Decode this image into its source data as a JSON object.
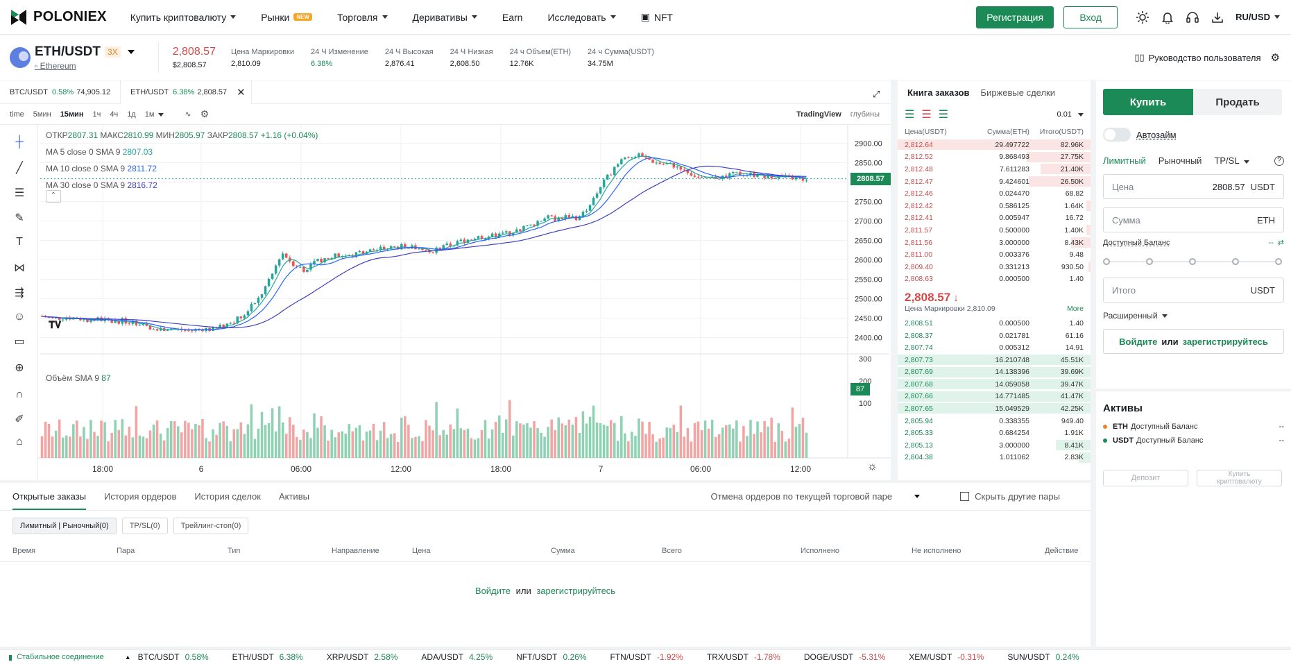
{
  "nav": {
    "brand": "POLONIEX",
    "items": [
      {
        "label": "Купить криптовалюту",
        "caret": true
      },
      {
        "label": "Рынки",
        "badge": "NEW"
      },
      {
        "label": "Торговля",
        "caret": true
      },
      {
        "label": "Деривативы",
        "caret": true
      },
      {
        "label": "Earn"
      },
      {
        "label": "Исследовать",
        "caret": true
      },
      {
        "label": "NFT"
      }
    ],
    "register": "Регистрация",
    "login": "Вход",
    "lang": "RU/USD"
  },
  "ticker": {
    "pair": "ETH/USDT",
    "leverage": "3X",
    "coin": "Ethereum",
    "price": "2,808.57",
    "price_usd": "$2,808.57",
    "stats": [
      {
        "label": "Цена Маркировки",
        "value": "2,810.09",
        "color": "#1b1f24"
      },
      {
        "label": "24 Ч Изменение",
        "value": "6.38%",
        "color": "#1c8a57"
      },
      {
        "label": "24 Ч Высокая",
        "value": "2,876.41",
        "color": "#1b1f24"
      },
      {
        "label": "24 Ч Низкая",
        "value": "2,608.50",
        "color": "#1b1f24"
      },
      {
        "label": "24 ч Объем(ETH)",
        "value": "12.76K",
        "color": "#1b1f24"
      },
      {
        "label": "24 ч Сумма(USDT)",
        "value": "34.75M",
        "color": "#1b1f24"
      }
    ],
    "guide": "Руководство пользователя"
  },
  "chart_tabs": [
    {
      "pair": "BTC/USDT",
      "change": "0.58%",
      "price": "74,905.12"
    },
    {
      "pair": "ETH/USDT",
      "change": "6.38%",
      "price": "2,808.57"
    }
  ],
  "toolbar": {
    "intervals": [
      "time",
      "5мин",
      "15мин",
      "1ч",
      "4ч",
      "1д",
      "1м"
    ],
    "tradingview": "TradingView",
    "depth": "глубины"
  },
  "chart_legend": {
    "ohlc": {
      "open_label": "ОТКР",
      "open": "2807.31",
      "high_label": "МАКС",
      "high": "2810.99",
      "low_label": "МИН",
      "low": "2805.97",
      "close_label": "ЗАКР",
      "close": "2808.57",
      "change": "+1.16 (+0.04%)"
    },
    "ma": [
      {
        "label": "MA 5 close 0 SMA 9",
        "value": "2807.03",
        "color": "#26a69a"
      },
      {
        "label": "MA 10 close 0 SMA 9",
        "value": "2811.72",
        "color": "#2962ff"
      },
      {
        "label": "MA 30 close 0 SMA 9",
        "value": "2816.72",
        "color": "#3f3fbf"
      }
    ],
    "volume_label": "Объём SMA 9",
    "volume_value": "87",
    "current_price_tag": "2808.57",
    "current_volume_tag": "87"
  },
  "chart_data": {
    "type": "candlestick",
    "price_axis": [
      "2900.00",
      "2850.00",
      "2800.00",
      "2750.00",
      "2700.00",
      "2650.00",
      "2600.00",
      "2550.00",
      "2500.00",
      "2450.00",
      "2400.00"
    ],
    "volume_axis": [
      "300",
      "200",
      "100"
    ],
    "time_axis": [
      "18:00",
      "6",
      "06:00",
      "12:00",
      "18:00",
      "7",
      "06:00",
      "12:00"
    ],
    "ylim": [
      2390,
      2915
    ],
    "close_path": [
      2455,
      2448,
      2452,
      2450,
      2445,
      2447,
      2440,
      2443,
      2438,
      2436,
      2418,
      2425,
      2420,
      2417,
      2423,
      2420,
      2432,
      2445,
      2470,
      2500,
      2550,
      2620,
      2590,
      2575,
      2595,
      2605,
      2612,
      2608,
      2620,
      2625,
      2628,
      2632,
      2635,
      2628,
      2622,
      2632,
      2640,
      2650,
      2658,
      2660,
      2664,
      2670,
      2680,
      2690,
      2710,
      2705,
      2712,
      2708,
      2740,
      2790,
      2830,
      2862,
      2870,
      2860,
      2848,
      2845,
      2838,
      2820,
      2805,
      2812,
      2815,
      2822,
      2820,
      2818,
      2815,
      2812,
      2810,
      2808
    ]
  },
  "orderbook": {
    "tabs": [
      "Книга заказов",
      "Биржевые сделки"
    ],
    "precision": "0.01",
    "headers": [
      "Цена(USDT)",
      "Сумма(ETH)",
      "Итого(USDT)"
    ],
    "asks": [
      {
        "price": "2,812.64",
        "amount": "29.497722",
        "total": "82.96K",
        "depth": 1.0
      },
      {
        "price": "2,812.52",
        "amount": "9.868493",
        "total": "27.75K",
        "depth": 0.33
      },
      {
        "price": "2,812.48",
        "amount": "7.611283",
        "total": "21.40K",
        "depth": 0.26
      },
      {
        "price": "2,812.47",
        "amount": "9.424601",
        "total": "26.50K",
        "depth": 0.32
      },
      {
        "price": "2,812.46",
        "amount": "0.024470",
        "total": "68.82",
        "depth": 0.0
      },
      {
        "price": "2,812.42",
        "amount": "0.586125",
        "total": "1.64K",
        "depth": 0.02
      },
      {
        "price": "2,812.41",
        "amount": "0.005947",
        "total": "16.72",
        "depth": 0.0
      },
      {
        "price": "2,811.57",
        "amount": "0.500000",
        "total": "1.40K",
        "depth": 0.02
      },
      {
        "price": "2,811.56",
        "amount": "3.000000",
        "total": "8.43K",
        "depth": 0.1
      },
      {
        "price": "2,811.00",
        "amount": "0.003376",
        "total": "9.48",
        "depth": 0.0
      },
      {
        "price": "2,809.40",
        "amount": "0.331213",
        "total": "930.50",
        "depth": 0.01
      },
      {
        "price": "2,808.63",
        "amount": "0.000500",
        "total": "1.40",
        "depth": 0.0
      }
    ],
    "last_price": "2,808.57",
    "mark_label": "Цена Маркировки 2,810.09",
    "more": "More",
    "bids": [
      {
        "price": "2,808.51",
        "amount": "0.000500",
        "total": "1.40",
        "depth": 0.0
      },
      {
        "price": "2,808.37",
        "amount": "0.021781",
        "total": "61.16",
        "depth": 0.0
      },
      {
        "price": "2,807.74",
        "amount": "0.005312",
        "total": "14.91",
        "depth": 0.0
      },
      {
        "price": "2,807.73",
        "amount": "16.210748",
        "total": "45.51K",
        "depth": 1.0
      },
      {
        "price": "2,807.69",
        "amount": "14.138396",
        "total": "39.69K",
        "depth": 1.0
      },
      {
        "price": "2,807.68",
        "amount": "14.059058",
        "total": "39.47K",
        "depth": 1.0
      },
      {
        "price": "2,807.66",
        "amount": "14.771485",
        "total": "41.47K",
        "depth": 1.0
      },
      {
        "price": "2,807.65",
        "amount": "15.049529",
        "total": "42.25K",
        "depth": 1.0
      },
      {
        "price": "2,805.94",
        "amount": "0.338355",
        "total": "949.40",
        "depth": 0.0
      },
      {
        "price": "2,805.33",
        "amount": "0.684254",
        "total": "1.91K",
        "depth": 0.0
      },
      {
        "price": "2,805.13",
        "amount": "3.000000",
        "total": "8.41K",
        "depth": 0.18
      },
      {
        "price": "2,804.38",
        "amount": "1.011062",
        "total": "2.83K",
        "depth": 0.06
      }
    ]
  },
  "trade": {
    "buy": "Купить",
    "sell": "Продать",
    "autoborrow": "Автозайм",
    "order_types": [
      "Лимитный",
      "Рыночный",
      "TP/SL"
    ],
    "price_label": "Цена",
    "price_value": "2808.57",
    "price_unit": "USDT",
    "amount_label": "Сумма",
    "amount_unit": "ETH",
    "available_label": "Доступный Баланс",
    "available_value": "--",
    "total_label": "Итого",
    "total_unit": "USDT",
    "advanced": "Расширенный",
    "login_text": "Войдите",
    "or_text": "или",
    "register_text": "зарегистрируйтесь"
  },
  "assets": {
    "title": "Активы",
    "items": [
      {
        "coin": "ETH",
        "label": "Доступный Баланс",
        "value": "--",
        "color": "#e4862c"
      },
      {
        "coin": "USDT",
        "label": "Доступный Баланс",
        "value": "--",
        "color": "#1c8a57"
      }
    ],
    "deposit": "Депозит",
    "buy_crypto": "Купить криптовалюту"
  },
  "orders": {
    "tabs": [
      "Открытые заказы",
      "История ордеров",
      "История сделок",
      "Активы"
    ],
    "cancel_label": "Отмена ордеров по текущей торговой паре",
    "hide_other": "Скрыть другие пары",
    "chips": [
      "Лимитный | Рыночный(0)",
      "TP/SL(0)",
      "Трейлинг-стоп(0)"
    ],
    "columns": [
      "Время",
      "Пара",
      "Тип",
      "Направление",
      "Цена",
      "Сумма",
      "Всего",
      "Исполнено",
      "Не исполнено",
      "Действие"
    ],
    "login_text": "Войдите",
    "or_text": "или",
    "register_text": "зарегистрируйтесь"
  },
  "status": {
    "connection": "Стабильное соединение",
    "tickers": [
      {
        "pair": "BTC/USDT",
        "change": "0.58%",
        "up": true
      },
      {
        "pair": "ETH/USDT",
        "change": "6.38%",
        "up": true
      },
      {
        "pair": "XRP/USDT",
        "change": "2.58%",
        "up": true
      },
      {
        "pair": "ADA/USDT",
        "change": "4.25%",
        "up": true
      },
      {
        "pair": "NFT/USDT",
        "change": "0.26%",
        "up": true
      },
      {
        "pair": "FTN/USDT",
        "change": "-1.92%",
        "up": false
      },
      {
        "pair": "TRX/USDT",
        "change": "-1.78%",
        "up": false
      },
      {
        "pair": "DOGE/USDT",
        "change": "-5.31%",
        "up": false
      },
      {
        "pair": "XEM/USDT",
        "change": "-0.31%",
        "up": false
      },
      {
        "pair": "SUN/USDT",
        "change": "0.24%",
        "up": true
      }
    ]
  }
}
